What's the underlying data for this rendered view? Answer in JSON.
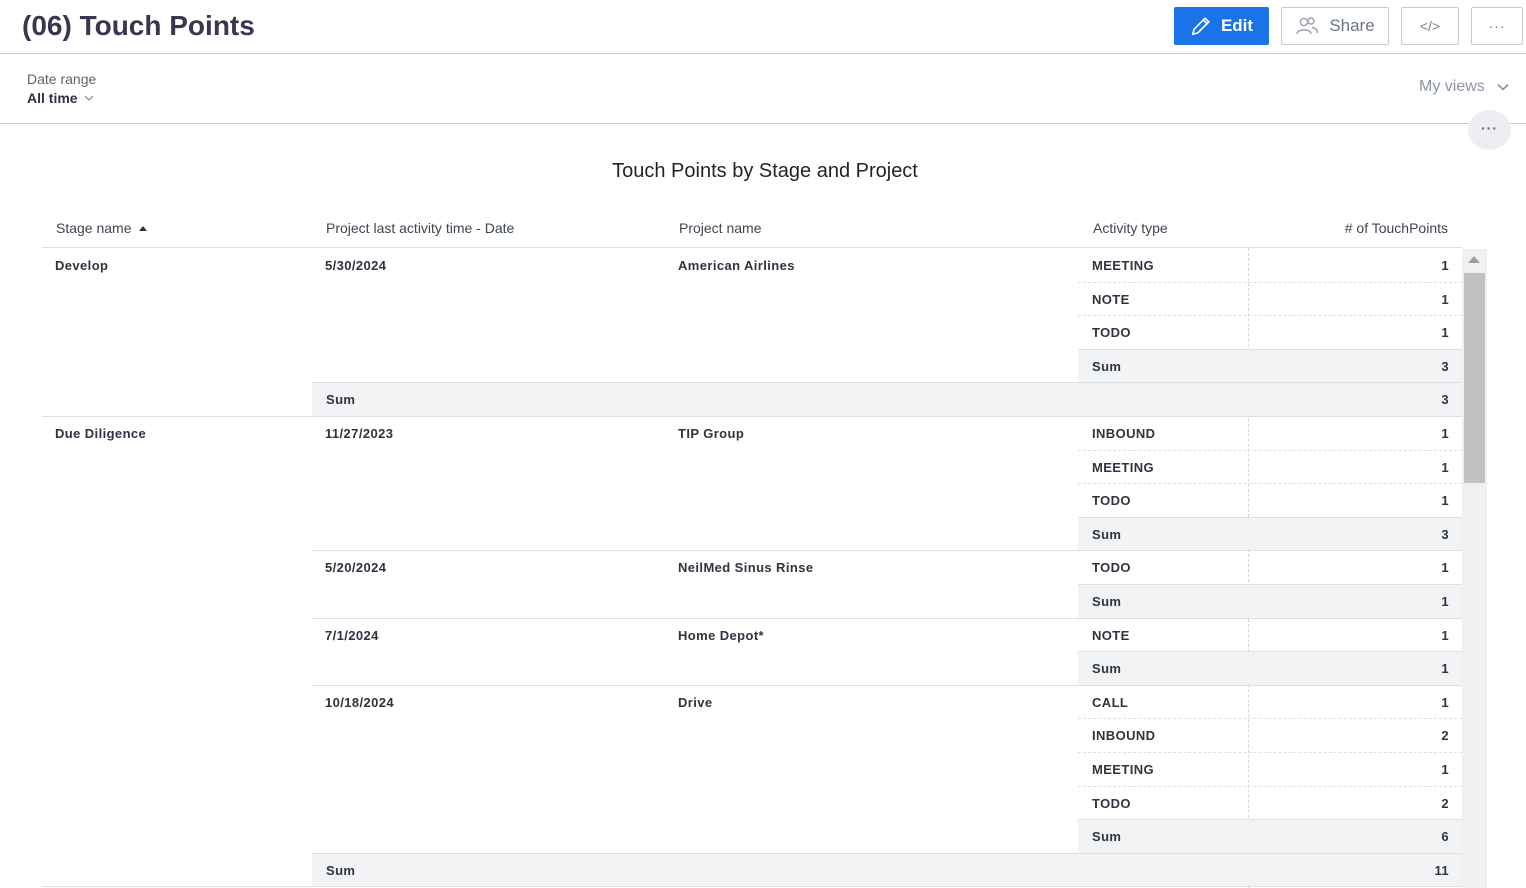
{
  "header": {
    "title": "(06) Touch Points",
    "edit_label": "Edit",
    "share_label": "Share",
    "embed_label": "</>",
    "more_label": "···"
  },
  "filters": {
    "date_range_label": "Date range",
    "date_range_value": "All time",
    "views_label": "My views"
  },
  "report": {
    "title": "Touch Points by Stage and Project",
    "more_label": "···",
    "columns": [
      "Stage name",
      "Project last activity time - Date",
      "Project name",
      "Activity type",
      "# of TouchPoints"
    ],
    "sum_label": "Sum",
    "stages": [
      {
        "name": "Develop",
        "projects": [
          {
            "date": "5/30/2024",
            "name": "American Airlines",
            "activities": [
              {
                "type": "MEETING",
                "count": "1"
              },
              {
                "type": "NOTE",
                "count": "1"
              },
              {
                "type": "TODO",
                "count": "1"
              }
            ],
            "sum": "3"
          }
        ],
        "sum": "3"
      },
      {
        "name": "Due Diligence",
        "projects": [
          {
            "date": "11/27/2023",
            "name": "TIP Group",
            "activities": [
              {
                "type": "INBOUND",
                "count": "1"
              },
              {
                "type": "MEETING",
                "count": "1"
              },
              {
                "type": "TODO",
                "count": "1"
              }
            ],
            "sum": "3"
          },
          {
            "date": "5/20/2024",
            "name": "NeilMed Sinus Rinse",
            "activities": [
              {
                "type": "TODO",
                "count": "1"
              }
            ],
            "sum": "1"
          },
          {
            "date": "7/1/2024",
            "name": "Home Depot*",
            "activities": [
              {
                "type": "NOTE",
                "count": "1"
              }
            ],
            "sum": "1"
          },
          {
            "date": "10/18/2024",
            "name": "Drive",
            "activities": [
              {
                "type": "CALL",
                "count": "1"
              },
              {
                "type": "INBOUND",
                "count": "2"
              },
              {
                "type": "MEETING",
                "count": "1"
              },
              {
                "type": "TODO",
                "count": "2"
              }
            ],
            "sum": "6"
          }
        ],
        "sum": "11"
      }
    ]
  }
}
